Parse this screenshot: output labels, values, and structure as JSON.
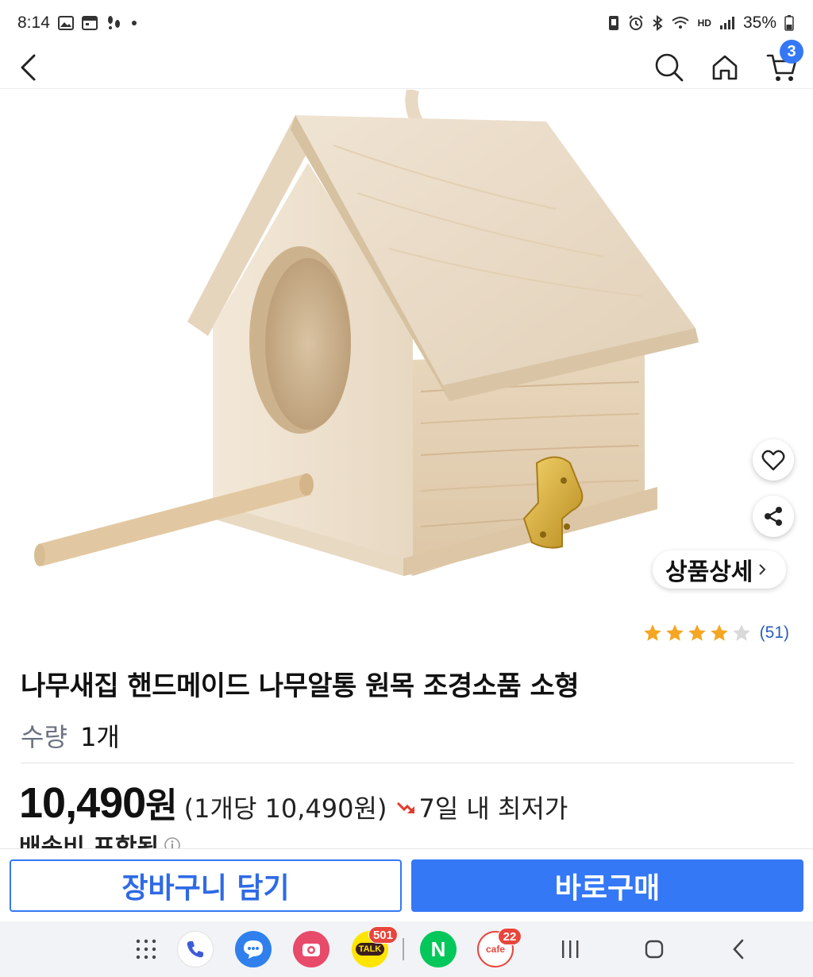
{
  "status_bar": {
    "time": "8:14",
    "battery": "35%",
    "network_label": "HD"
  },
  "app_bar": {
    "cart_count": "3",
    "icons": [
      "back-icon",
      "search-icon",
      "home-icon",
      "cart-icon"
    ]
  },
  "product": {
    "detail_button": "상품상세",
    "rating": 4,
    "rating_max": 5,
    "review_count": "(51)",
    "title": "나무새집 핸드메이드 나무알통 원목 조경소품 소형",
    "quantity_label": "수량",
    "quantity_value": "1개",
    "price": "10,490",
    "currency": "원",
    "unit_price": "(1개당 10,490원)",
    "lowest_label": "7일 내 최저가",
    "shipping": "배송비 포함됨"
  },
  "actions": {
    "cart_button": "장바구니 담기",
    "buy_button": "바로구매"
  },
  "nav": {
    "kakao_talk_badge": "501",
    "kakao_talk_label": "TALK",
    "naver_label": "N",
    "cafe_badge": "22",
    "cafe_label": "cafe"
  },
  "colors": {
    "accent": "#3478f6",
    "star": "#f5a623",
    "star_empty": "#d9d9d9",
    "badge": "#e8453c"
  }
}
